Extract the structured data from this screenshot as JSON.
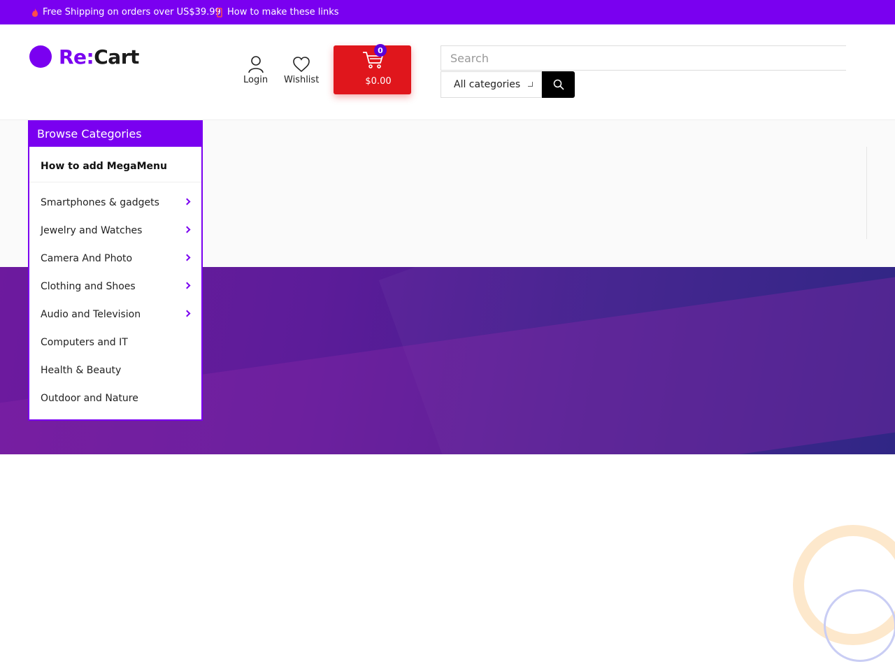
{
  "topbar": {
    "shipping": "Free Shipping on orders over US$39.99",
    "links": "How to make these links"
  },
  "logo": {
    "prefix": "Re:",
    "suffix": "Cart"
  },
  "header": {
    "login": "Login",
    "wishlist": "Wishlist",
    "cart_count": "0",
    "cart_total": "$0.00"
  },
  "search": {
    "placeholder": "Search",
    "category": "All categories"
  },
  "sidebar": {
    "title": "Browse Categories",
    "mega": "How to add MegaMenu",
    "items": [
      {
        "label": "Smartphones & gadgets",
        "has_sub": true
      },
      {
        "label": "Jewelry and Watches",
        "has_sub": true
      },
      {
        "label": "Camera And Photo",
        "has_sub": true
      },
      {
        "label": "Clothing and Shoes",
        "has_sub": true
      },
      {
        "label": "Audio and Television",
        "has_sub": true
      },
      {
        "label": "Computers and IT",
        "has_sub": false
      },
      {
        "label": "Health & Beauty",
        "has_sub": false
      },
      {
        "label": "Outdoor and Nature",
        "has_sub": false
      }
    ]
  },
  "colors": {
    "accent": "#7a00f0",
    "cart": "#e0161c",
    "ring_orange": "#fde8cc",
    "ring_blue": "#c9cdf4"
  }
}
